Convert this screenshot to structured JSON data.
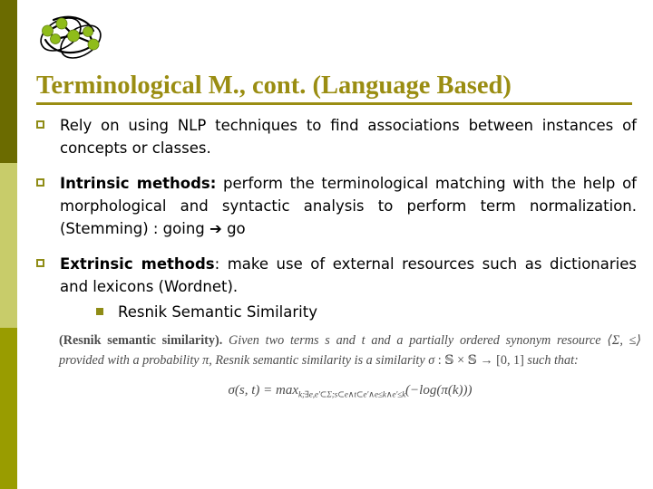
{
  "sidebar": {
    "bands": [
      {
        "name": "top",
        "color": "#6b6b00"
      },
      {
        "name": "middle",
        "color": "#c8cc6a"
      },
      {
        "name": "bottom",
        "color": "#999c00"
      }
    ]
  },
  "logo": {
    "name": "network-graph-logo",
    "node_color": "#8fbc1a",
    "outline_color": "#000000"
  },
  "header": {
    "title": "Terminological M., cont. (Language Based)",
    "title_color": "#9a8d12"
  },
  "body": {
    "bullets": [
      {
        "marker": "hollow-square",
        "lead": "",
        "text": "Rely on using NLP techniques to find associations between instances of concepts or classes."
      },
      {
        "marker": "hollow-square",
        "lead": "Intrinsic methods:",
        "text": " perform the terminological matching with the help of morphological and syntactic analysis to perform term normalization. (Stemming)  : going ➔ go"
      },
      {
        "marker": "hollow-square",
        "lead": "Extrinsic methods",
        "text": ": make use of external resources such as dictionaries and lexicons (Wordnet)."
      }
    ],
    "sub_bullets": [
      {
        "marker": "filled-square",
        "text": "Resnik Semantic Similarity"
      }
    ]
  },
  "definition": {
    "name": "(Resnik semantic similarity).",
    "text_part_1": " Given two terms ",
    "term_s": "s",
    "and_1": " and ",
    "term_t": "t",
    "text_part_2": " and a partially ordered synonym resource ",
    "resource": "⟨Σ, ≤⟩",
    "text_part_3": " provided with a probability ",
    "prob": "π",
    "text_part_4": ", Resnik semantic similarity is a similarity ",
    "sigma": "σ",
    "mapping": " : 𝕊 × 𝕊 → [0, 1] ",
    "text_part_5": "such that:",
    "formula_main": "σ(s, t) = max",
    "formula_sub": "k;∃e,e'⊂Σ;s⊂e∧t⊂e'∧e≤k∧e'≤k",
    "formula_tail": "(−log(π(k)))"
  },
  "colors": {
    "olive_dark": "#6b6b00",
    "olive_light": "#c8cc6a",
    "olive_mid": "#999c00",
    "title": "#9a8d12",
    "bullet_marker": "#8f8c16",
    "node_green": "#8fbc1a"
  }
}
